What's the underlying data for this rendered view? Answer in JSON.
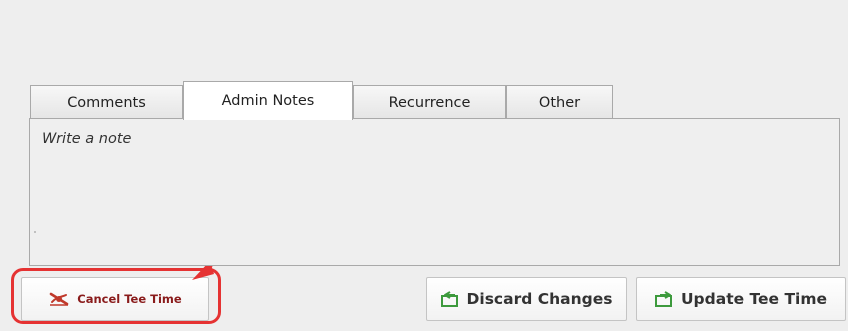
{
  "tabs": [
    {
      "label": "Comments",
      "active": false
    },
    {
      "label": "Admin Notes",
      "active": true
    },
    {
      "label": "Recurrence",
      "active": false
    },
    {
      "label": "Other",
      "active": false
    }
  ],
  "note": {
    "placeholder": "Write a note",
    "value": ""
  },
  "buttons": {
    "cancel": {
      "label": "Cancel Tee Time",
      "icon": "cancel-tee-time-icon"
    },
    "discard": {
      "label": "Discard Changes",
      "icon": "discard-icon"
    },
    "update": {
      "label": "Update Tee Time",
      "icon": "update-icon"
    }
  },
  "colors": {
    "annotation": "#e53232",
    "icon_green": "#3d9a3d",
    "icon_red": "#c0392b",
    "cancel_text": "#8a1c1c"
  }
}
